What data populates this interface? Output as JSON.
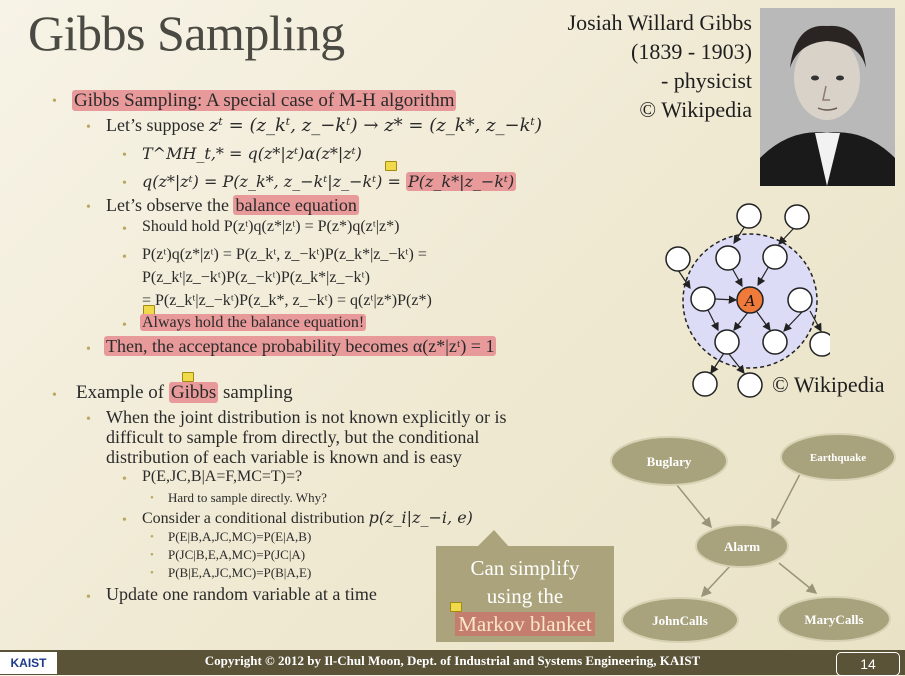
{
  "title": "Gibbs Sampling",
  "bio": {
    "name": "Josiah Willard Gibbs",
    "years": "(1839 - 1903)",
    "role": "- physicist",
    "credit": "© Wikipedia"
  },
  "bullets": {
    "b1": "Gibbs Sampling: A special case of M-H algorithm",
    "b1_1": "Let’s suppose ",
    "b1_1_math": "zᵗ = (z_kᵗ, z_−kᵗ) → z* = (z_k*, z_−kᵗ)",
    "b1_1_1": "T^MH_t,* = q(z*|zᵗ)α(z*|zᵗ)",
    "b1_1_2a": "q(z*|zᵗ) = P(z_k*, z_−kᵗ|z_−kᵗ) = ",
    "b1_1_2b": "P(z_k*|z_−kᵗ)",
    "b1_2a": "Let’s observe the ",
    "b1_2b": "balance equation",
    "b1_2_1": "Should hold P(zᵗ)q(z*|zᵗ) = P(z*)q(zᵗ|z*)",
    "b1_2_2a": "P(zᵗ)q(z*|zᵗ) = P(z_kᵗ, z_−kᵗ)P(z_k*|z_−kᵗ) =",
    "b1_2_2b": "P(z_kᵗ|z_−kᵗ)P(z_−kᵗ)P(z_k*|z_−kᵗ)",
    "b1_2_2c": "= P(z_kᵗ|z_−kᵗ)P(z_k*, z_−kᵗ) = q(zᵗ|z*)P(z*)",
    "b1_2_3": "Always hold the balance equation!",
    "b1_3": "Then, the acceptance probability becomes α(z*|zᵗ) = 1",
    "b2a": "Example of ",
    "b2b": "Gibbs",
    "b2c": " sampling",
    "b2_1a": "When the joint distribution is not known explicitly or is",
    "b2_1b": "difficult to sample from directly, but the conditional",
    "b2_1c": "distribution of each variable is known and is easy",
    "b2_1_1": "P(E,JC,B|A=F,MC=T)=?",
    "b2_1_1_1": "Hard to sample directly. Why?",
    "b2_1_2a": "Consider a conditional distribution ",
    "b2_1_2b": "p(z_i|z_−i, e)",
    "b2_1_2_1": "P(E|B,A,JC,MC)=P(E|A,B)",
    "b2_1_2_2": "P(JC|B,E,A,MC)=P(JC|A)",
    "b2_1_2_3": "P(B|E,A,JC,MC)=P(B|A,E)",
    "b2_2": "Update one random variable at a time"
  },
  "callout": {
    "line1": "Can simplify",
    "line2": "using the",
    "line3": "Markov blanket"
  },
  "network_credit": "© Wikipedia",
  "markov_node": "A",
  "bayes_net": {
    "nodes": [
      "Buglary",
      "Earthquake",
      "Alarm",
      "JohnCalls",
      "MaryCalls"
    ]
  },
  "footer": {
    "logo": "KAIST",
    "copyright": "Copyright © 2012 by Il-Chul Moon, Dept. of Industrial and Systems Engineering, KAIST",
    "page": "14"
  },
  "colors": {
    "highlight": "#e89a9a",
    "bullet": "#b8a85e",
    "node_fill": "#a8a27d",
    "footer": "#5a5338",
    "markov_center": "#f07a3a"
  }
}
